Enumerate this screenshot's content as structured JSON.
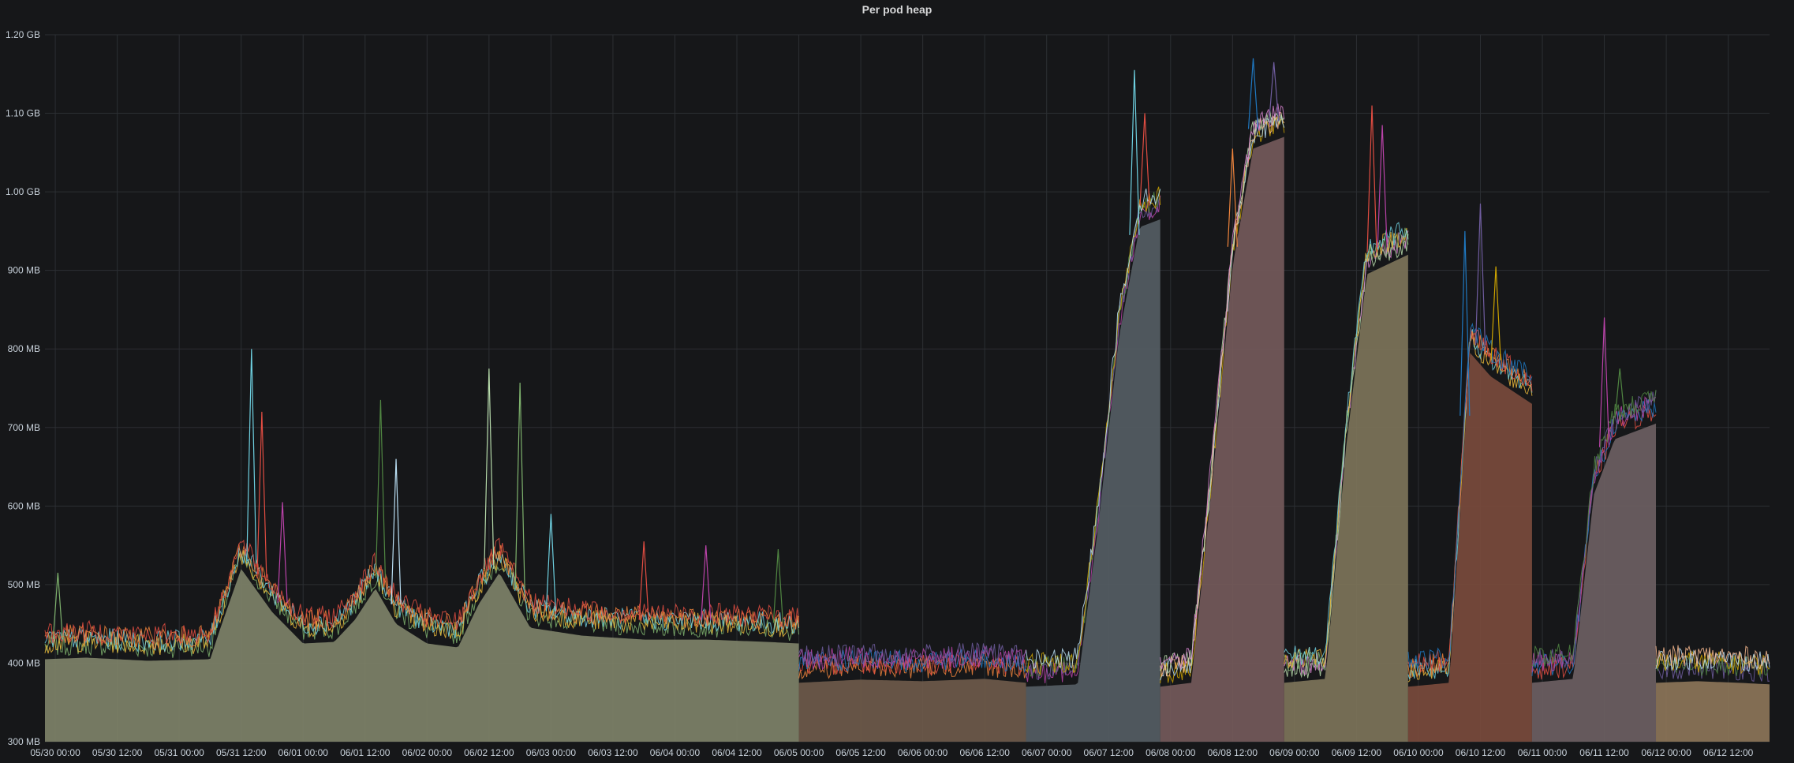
{
  "panel": {
    "title": "Per pod heap"
  },
  "chart_data": {
    "type": "area",
    "title": "Per pod heap",
    "xlabel": "",
    "ylabel": "",
    "ylim": [
      300,
      1200
    ],
    "y_unit": "MB",
    "y_ticks": [
      {
        "value": 300,
        "label": "300 MB"
      },
      {
        "value": 400,
        "label": "400 MB"
      },
      {
        "value": 500,
        "label": "500 MB"
      },
      {
        "value": 600,
        "label": "600 MB"
      },
      {
        "value": 700,
        "label": "700 MB"
      },
      {
        "value": 800,
        "label": "800 MB"
      },
      {
        "value": 900,
        "label": "900 MB"
      },
      {
        "value": 1000,
        "label": "1.00 GB"
      },
      {
        "value": 1100,
        "label": "1.10 GB"
      },
      {
        "value": 1200,
        "label": "1.20 GB"
      }
    ],
    "x_range": [
      "05/29 22:00",
      "06/12 20:00"
    ],
    "x_ticks": [
      "05/30 00:00",
      "05/30 12:00",
      "05/31 00:00",
      "05/31 12:00",
      "06/01 00:00",
      "06/01 12:00",
      "06/02 00:00",
      "06/02 12:00",
      "06/03 00:00",
      "06/03 12:00",
      "06/04 00:00",
      "06/04 12:00",
      "06/05 00:00",
      "06/05 12:00",
      "06/06 00:00",
      "06/06 12:00",
      "06/07 00:00",
      "06/07 12:00",
      "06/08 00:00",
      "06/08 12:00",
      "06/09 00:00",
      "06/09 12:00",
      "06/10 00:00",
      "06/10 12:00",
      "06/11 00:00",
      "06/11 12:00",
      "06/12 00:00",
      "06/12 12:00"
    ],
    "grid": true,
    "legend": "none",
    "series_colors": [
      "#7eb26d",
      "#eab839",
      "#6ed0e0",
      "#ef843c",
      "#e24d42",
      "#1f78c1",
      "#ba43a9",
      "#705da0",
      "#508642",
      "#cca300",
      "#badff4",
      "#f9ba8f",
      "#b7dbab",
      "#d683ce"
    ],
    "deployments": [
      {
        "start": "05/29 22:00",
        "end": "06/05 00:00",
        "fill": "#7e8268",
        "points": [
          [
            "05/29 22:00",
            430
          ],
          [
            "05/30 06:00",
            432
          ],
          [
            "05/30 18:00",
            428
          ],
          [
            "05/31 06:00",
            430
          ],
          [
            "05/31 08:00",
            470
          ],
          [
            "05/31 12:00",
            545
          ],
          [
            "05/31 18:00",
            490
          ],
          [
            "06/01 00:00",
            450
          ],
          [
            "06/01 06:00",
            452
          ],
          [
            "06/01 10:00",
            480
          ],
          [
            "06/01 14:00",
            520
          ],
          [
            "06/01 18:00",
            475
          ],
          [
            "06/02 00:00",
            450
          ],
          [
            "06/02 06:00",
            445
          ],
          [
            "06/02 10:00",
            500
          ],
          [
            "06/02 14:00",
            540
          ],
          [
            "06/02 20:00",
            470
          ],
          [
            "06/03 06:00",
            460
          ],
          [
            "06/03 18:00",
            455
          ],
          [
            "06/04 06:00",
            455
          ],
          [
            "06/04 18:00",
            452
          ],
          [
            "06/05 00:00",
            450
          ]
        ],
        "spikes": [
          [
            "05/30 00:30",
            515
          ],
          [
            "05/31 14:00",
            800
          ],
          [
            "05/31 16:00",
            720
          ],
          [
            "05/31 20:00",
            605
          ],
          [
            "06/01 15:00",
            735
          ],
          [
            "06/01 18:00",
            660
          ],
          [
            "06/02 12:00",
            775
          ],
          [
            "06/02 18:00",
            757
          ],
          [
            "06/03 00:00",
            590
          ],
          [
            "06/03 18:00",
            555
          ],
          [
            "06/04 06:00",
            550
          ],
          [
            "06/04 20:00",
            545
          ]
        ]
      },
      {
        "start": "06/05 00:00",
        "end": "06/06 20:00",
        "fill": "#6e5a4a",
        "points": [
          [
            "06/05 00:00",
            400
          ],
          [
            "06/05 12:00",
            404
          ],
          [
            "06/06 00:00",
            402
          ],
          [
            "06/06 12:00",
            405
          ],
          [
            "06/06 20:00",
            400
          ]
        ],
        "spikes": []
      },
      {
        "start": "06/06 20:00",
        "end": "06/07 22:00",
        "fill": "#555d63",
        "points": [
          [
            "06/06 20:00",
            395
          ],
          [
            "06/07 06:00",
            398
          ],
          [
            "06/07 10:00",
            600
          ],
          [
            "06/07 14:00",
            840
          ],
          [
            "06/07 18:00",
            980
          ],
          [
            "06/07 22:00",
            990
          ]
        ],
        "spikes": [
          [
            "06/07 17:00",
            1155
          ],
          [
            "06/07 19:00",
            1100
          ]
        ]
      },
      {
        "start": "06/07 22:00",
        "end": "06/08 22:00",
        "fill": "#745a5a",
        "points": [
          [
            "06/07 22:00",
            395
          ],
          [
            "06/08 04:00",
            400
          ],
          [
            "06/08 08:00",
            650
          ],
          [
            "06/08 12:00",
            930
          ],
          [
            "06/08 16:00",
            1080
          ],
          [
            "06/08 22:00",
            1095
          ]
        ],
        "spikes": [
          [
            "06/08 12:00",
            1055
          ],
          [
            "06/08 16:00",
            1170
          ],
          [
            "06/08 20:00",
            1165
          ]
        ]
      },
      {
        "start": "06/08 22:00",
        "end": "06/09 22:00",
        "fill": "#7d7459",
        "points": [
          [
            "06/08 22:00",
            400
          ],
          [
            "06/09 06:00",
            405
          ],
          [
            "06/09 10:00",
            700
          ],
          [
            "06/09 14:00",
            920
          ],
          [
            "06/09 22:00",
            945
          ]
        ],
        "spikes": [
          [
            "06/09 15:00",
            1110
          ],
          [
            "06/09 17:00",
            1085
          ]
        ]
      },
      {
        "start": "06/09 22:00",
        "end": "06/10 22:00",
        "fill": "#7a4b3c",
        "points": [
          [
            "06/09 22:00",
            395
          ],
          [
            "06/10 06:00",
            400
          ],
          [
            "06/10 10:00",
            820
          ],
          [
            "06/10 14:00",
            790
          ],
          [
            "06/10 22:00",
            755
          ]
        ],
        "spikes": [
          [
            "06/10 09:00",
            950
          ],
          [
            "06/10 12:00",
            985
          ],
          [
            "06/10 15:00",
            905
          ]
        ]
      },
      {
        "start": "06/10 22:00",
        "end": "06/11 22:00",
        "fill": "#6d5f62",
        "points": [
          [
            "06/10 22:00",
            400
          ],
          [
            "06/11 06:00",
            405
          ],
          [
            "06/11 10:00",
            640
          ],
          [
            "06/11 14:00",
            710
          ],
          [
            "06/11 22:00",
            730
          ]
        ],
        "spikes": [
          [
            "06/11 12:00",
            840
          ],
          [
            "06/11 15:00",
            775
          ]
        ]
      },
      {
        "start": "06/11 22:00",
        "end": "06/12 20:00",
        "fill": "#8c7558",
        "points": [
          [
            "06/11 22:00",
            400
          ],
          [
            "06/12 06:00",
            402
          ],
          [
            "06/12 14:00",
            400
          ],
          [
            "06/12 20:00",
            398
          ]
        ],
        "spikes": []
      }
    ]
  }
}
